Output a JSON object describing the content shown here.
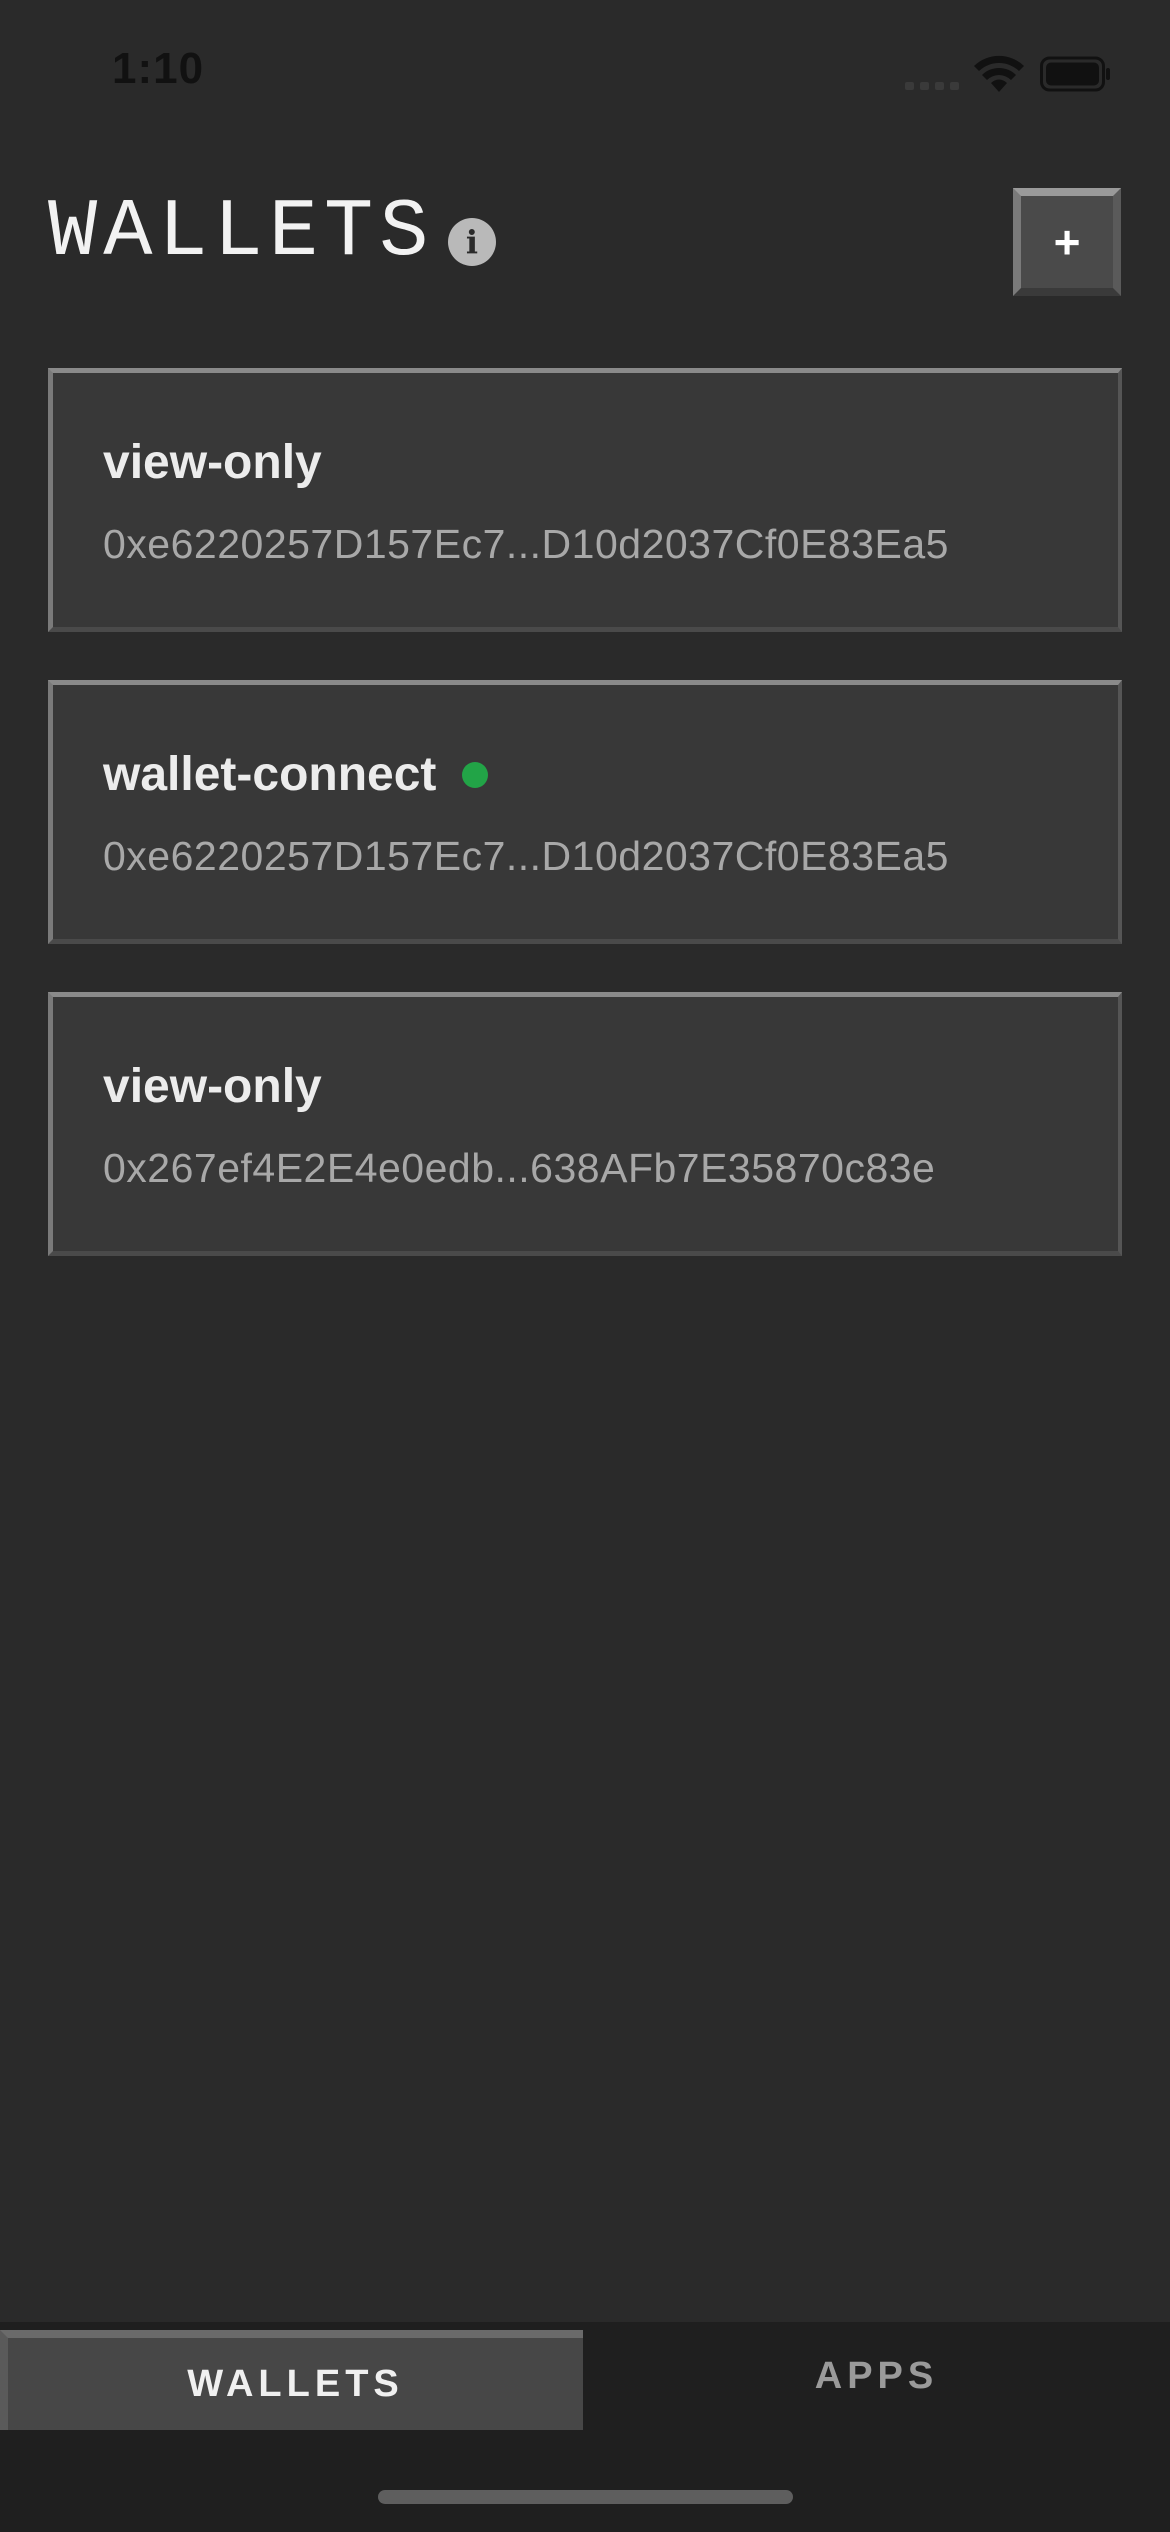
{
  "status_bar": {
    "time": "1:10",
    "icons": [
      "signal-icon",
      "wifi-icon",
      "battery-icon"
    ]
  },
  "header": {
    "title": "WALLETS",
    "info_icon": "info-icon",
    "add_label": "+"
  },
  "wallets": [
    {
      "name": "view-only",
      "address": "0xe6220257D157Ec7...D10d2037Cf0E83Ea5",
      "connected": false
    },
    {
      "name": "wallet-connect",
      "address": "0xe6220257D157Ec7...D10d2037Cf0E83Ea5",
      "connected": true
    },
    {
      "name": "view-only",
      "address": "0x267ef4E2E4e0edb...638AFb7E35870c83e",
      "connected": false
    }
  ],
  "tabs": [
    {
      "label": "WALLETS",
      "active": true
    },
    {
      "label": "APPS",
      "active": false
    }
  ],
  "colors": {
    "background": "#2a2a2a",
    "card": "#383838",
    "connected_dot": "#22a447",
    "tab_bar": "#1f1f1f"
  }
}
